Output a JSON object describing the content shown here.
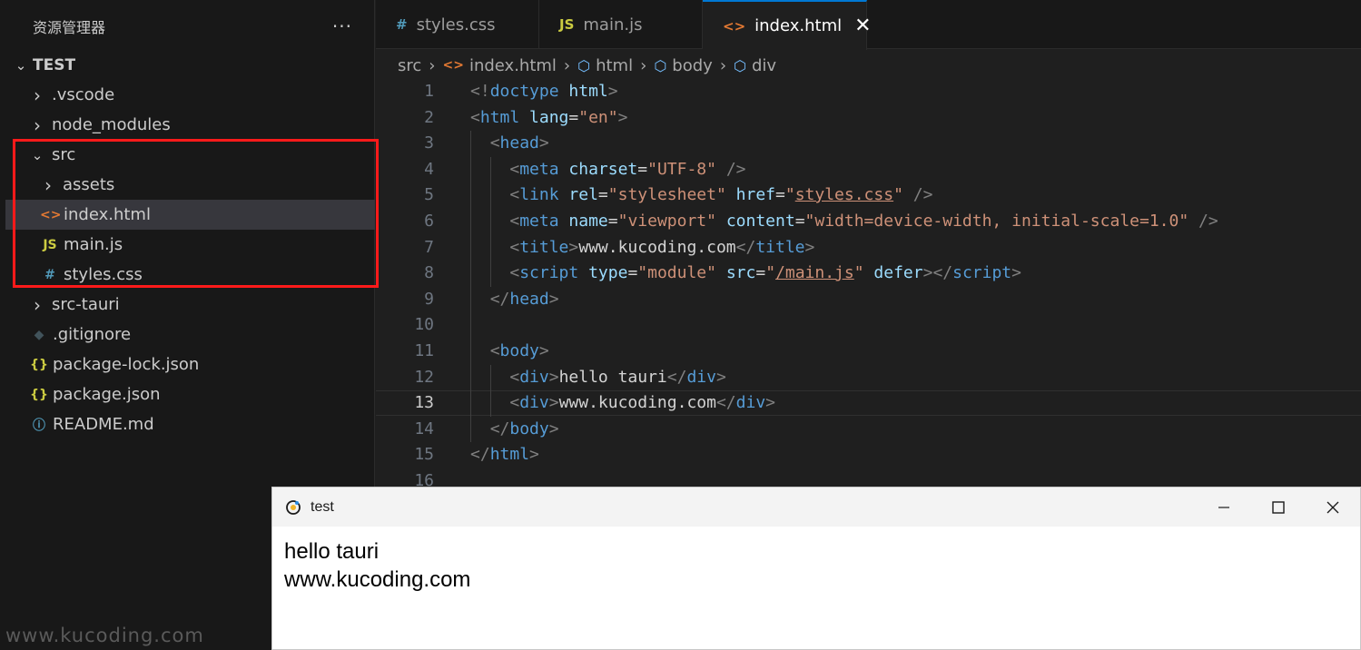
{
  "sidebar": {
    "title": "资源管理器",
    "more_label": "···",
    "root": "TEST",
    "items": [
      {
        "label": ".vscode",
        "kind": "folder-closed"
      },
      {
        "label": "node_modules",
        "kind": "folder-closed"
      },
      {
        "label": "src",
        "kind": "folder-open"
      },
      {
        "label": "assets",
        "kind": "folder-closed"
      },
      {
        "label": "index.html",
        "kind": "html-file",
        "icon": "<>"
      },
      {
        "label": "main.js",
        "kind": "js-file",
        "icon": "JS"
      },
      {
        "label": "styles.css",
        "kind": "css-file",
        "icon": "#"
      },
      {
        "label": "src-tauri",
        "kind": "folder-closed"
      },
      {
        "label": ".gitignore",
        "kind": "git-file",
        "icon": "◆"
      },
      {
        "label": "package-lock.json",
        "kind": "json-file",
        "icon": "{}"
      },
      {
        "label": "package.json",
        "kind": "json-file",
        "icon": "{}"
      },
      {
        "label": "README.md",
        "kind": "info-file",
        "icon": "ⓘ"
      }
    ],
    "highlight_color": "#ff1a1a"
  },
  "tabs": [
    {
      "label": "styles.css",
      "icon": "#",
      "active": false
    },
    {
      "label": "main.js",
      "icon": "JS",
      "active": false
    },
    {
      "label": "index.html",
      "icon": "<>",
      "active": true,
      "close": "✕"
    }
  ],
  "breadcrumb": [
    "src",
    "index.html",
    "html",
    "body",
    "div"
  ],
  "editor": {
    "current_line": 13,
    "line_numbers": [
      "1",
      "2",
      "3",
      "4",
      "5",
      "6",
      "7",
      "8",
      "9",
      "10",
      "11",
      "12",
      "13",
      "14",
      "15",
      "16"
    ],
    "lines": [
      [
        [
          "t",
          "<!"
        ],
        [
          "tag",
          "doctype"
        ],
        [
          "txt",
          " "
        ],
        [
          "attr",
          "html"
        ],
        [
          "t",
          ">"
        ]
      ],
      [
        [
          "t",
          "<"
        ],
        [
          "tag",
          "html"
        ],
        [
          "txt",
          " "
        ],
        [
          "attr",
          "lang"
        ],
        [
          "txt",
          "="
        ],
        [
          "str",
          "\"en\""
        ],
        [
          "t",
          ">"
        ]
      ],
      [
        [
          "txt",
          "  "
        ],
        [
          "t",
          "<"
        ],
        [
          "tag",
          "head"
        ],
        [
          "t",
          ">"
        ]
      ],
      [
        [
          "txt",
          "    "
        ],
        [
          "t",
          "<"
        ],
        [
          "tag",
          "meta"
        ],
        [
          "txt",
          " "
        ],
        [
          "attr",
          "charset"
        ],
        [
          "txt",
          "="
        ],
        [
          "str",
          "\"UTF-8\""
        ],
        [
          "txt",
          " "
        ],
        [
          "t",
          "/>"
        ]
      ],
      [
        [
          "txt",
          "    "
        ],
        [
          "t",
          "<"
        ],
        [
          "tag",
          "link"
        ],
        [
          "txt",
          " "
        ],
        [
          "attr",
          "rel"
        ],
        [
          "txt",
          "="
        ],
        [
          "str",
          "\"stylesheet\""
        ],
        [
          "txt",
          " "
        ],
        [
          "attr",
          "href"
        ],
        [
          "txt",
          "="
        ],
        [
          "str",
          "\""
        ],
        [
          "strlink",
          "styles.css"
        ],
        [
          "str",
          "\""
        ],
        [
          "txt",
          " "
        ],
        [
          "t",
          "/>"
        ]
      ],
      [
        [
          "txt",
          "    "
        ],
        [
          "t",
          "<"
        ],
        [
          "tag",
          "meta"
        ],
        [
          "txt",
          " "
        ],
        [
          "attr",
          "name"
        ],
        [
          "txt",
          "="
        ],
        [
          "str",
          "\"viewport\""
        ],
        [
          "txt",
          " "
        ],
        [
          "attr",
          "content"
        ],
        [
          "txt",
          "="
        ],
        [
          "str",
          "\"width=device-width, initial-scale=1.0\""
        ],
        [
          "txt",
          " "
        ],
        [
          "t",
          "/>"
        ]
      ],
      [
        [
          "txt",
          "    "
        ],
        [
          "t",
          "<"
        ],
        [
          "tag",
          "title"
        ],
        [
          "t",
          ">"
        ],
        [
          "txt",
          "www.kucoding.com"
        ],
        [
          "t",
          "</"
        ],
        [
          "tag",
          "title"
        ],
        [
          "t",
          ">"
        ]
      ],
      [
        [
          "txt",
          "    "
        ],
        [
          "t",
          "<"
        ],
        [
          "tag",
          "script"
        ],
        [
          "txt",
          " "
        ],
        [
          "attr",
          "type"
        ],
        [
          "txt",
          "="
        ],
        [
          "str",
          "\"module\""
        ],
        [
          "txt",
          " "
        ],
        [
          "attr",
          "src"
        ],
        [
          "txt",
          "="
        ],
        [
          "str",
          "\""
        ],
        [
          "strlink",
          "/main.js"
        ],
        [
          "str",
          "\""
        ],
        [
          "txt",
          " "
        ],
        [
          "attr",
          "defer"
        ],
        [
          "t",
          "></"
        ],
        [
          "tag",
          "script"
        ],
        [
          "t",
          ">"
        ]
      ],
      [
        [
          "txt",
          "  "
        ],
        [
          "t",
          "</"
        ],
        [
          "tag",
          "head"
        ],
        [
          "t",
          ">"
        ]
      ],
      [],
      [
        [
          "txt",
          "  "
        ],
        [
          "t",
          "<"
        ],
        [
          "tag",
          "body"
        ],
        [
          "t",
          ">"
        ]
      ],
      [
        [
          "txt",
          "    "
        ],
        [
          "t",
          "<"
        ],
        [
          "tag",
          "div"
        ],
        [
          "t",
          ">"
        ],
        [
          "txt",
          "hello tauri"
        ],
        [
          "t",
          "</"
        ],
        [
          "tag",
          "div"
        ],
        [
          "t",
          ">"
        ]
      ],
      [
        [
          "txt",
          "    "
        ],
        [
          "t",
          "<"
        ],
        [
          "tag",
          "div"
        ],
        [
          "t",
          ">"
        ],
        [
          "txt",
          "www.kucoding.com"
        ],
        [
          "t",
          "</"
        ],
        [
          "tag",
          "div"
        ],
        [
          "t",
          ">"
        ]
      ],
      [
        [
          "txt",
          "  "
        ],
        [
          "t",
          "</"
        ],
        [
          "tag",
          "body"
        ],
        [
          "t",
          ">"
        ]
      ],
      [
        [
          "t",
          "</"
        ],
        [
          "tag",
          "html"
        ],
        [
          "t",
          ">"
        ]
      ],
      []
    ]
  },
  "app_window": {
    "title": "test",
    "minimize": "—",
    "maximize": "☐",
    "close": "✕",
    "content": [
      "hello tauri",
      "www.kucoding.com"
    ]
  },
  "watermark": "www.kucoding.com"
}
